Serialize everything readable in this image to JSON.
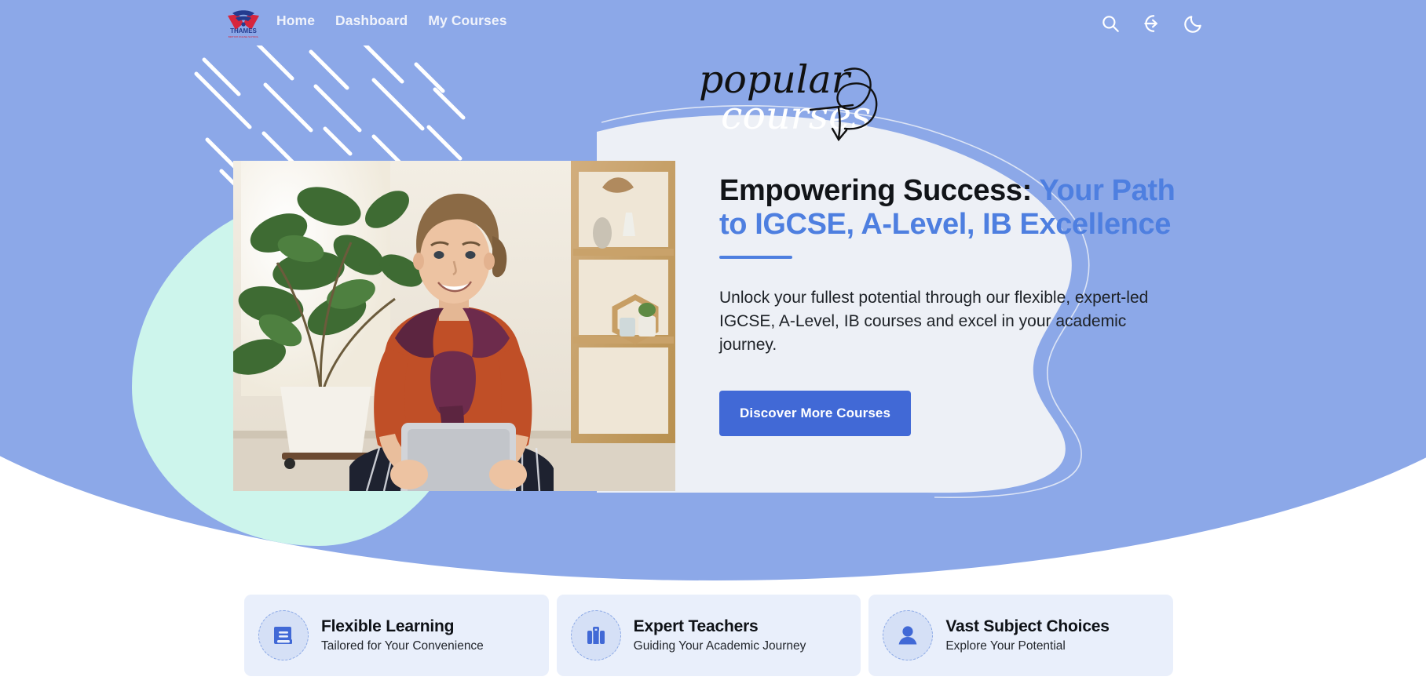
{
  "brand": {
    "logo_text": "THAMES",
    "logo_sub": "BRITISH ONLINE SCHOOL",
    "icon_name": "thames-wing-logo"
  },
  "nav": {
    "items": [
      {
        "label": "Home",
        "name": "nav-home"
      },
      {
        "label": "Dashboard",
        "name": "nav-dashboard"
      },
      {
        "label": "My Courses",
        "name": "nav-my-courses"
      }
    ]
  },
  "header_icons": [
    {
      "name": "search-icon",
      "label": "Search"
    },
    {
      "name": "login-icon",
      "label": "Log in"
    },
    {
      "name": "dark-mode-moon-icon",
      "label": "Dark mode"
    }
  ],
  "decoration": {
    "script_top": "popular",
    "script_bottom": "courses",
    "arrow_name": "curly-arrow-doodle",
    "stripes_name": "diagonal-stripes-pattern",
    "mint_blob_name": "mint-blob-shape",
    "wave_card_name": "wavy-white-panel"
  },
  "hero": {
    "heading_dark": "Empowering Success:",
    "heading_accent_1": "Your Path",
    "heading_accent_2": "to IGCSE, A-Level, IB Excellence",
    "paragraph": "Unlock your fullest potential through our flexible, expert-led IGCSE, A-Level, IB courses and excel in your academic journey.",
    "cta_label": "Discover More Courses",
    "image_alt": "Smiling student sitting with a tablet beside houseplants"
  },
  "features": [
    {
      "title": "Flexible Learning",
      "subtitle": "Tailored for Your Convenience",
      "icon": "book-icon"
    },
    {
      "title": "Expert Teachers",
      "subtitle": "Guiding Your Academic Journey",
      "icon": "briefcase-icon"
    },
    {
      "title": "Vast Subject Choices",
      "subtitle": "Explore Your Potential",
      "icon": "user-icon"
    }
  ],
  "colors": {
    "background_blue": "#8CA8E8",
    "accent_blue": "#4E7FE0",
    "cta_blue": "#4169D6",
    "mint": "#CDF5EC",
    "panel_white": "#EDF0F6",
    "card_bg": "#E9EFFB",
    "logo_red": "#D7263D"
  }
}
